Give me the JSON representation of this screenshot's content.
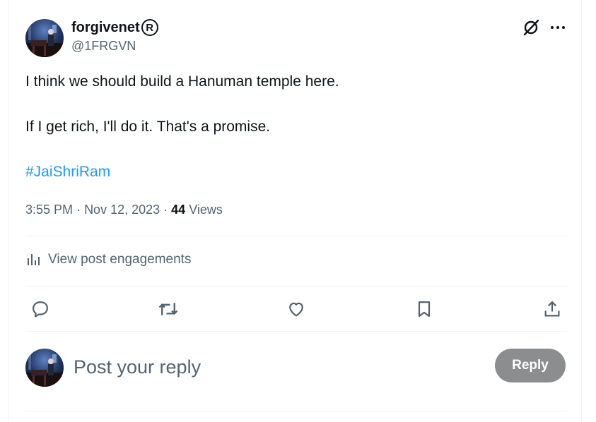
{
  "author": {
    "display_name": "forgivenet",
    "verified_mark": "R",
    "handle": "@1FRGVN",
    "avatar": "pianist-avatar"
  },
  "top_icons": [
    "grok-slash-icon",
    "more-icon"
  ],
  "post": {
    "lines": [
      "I think we should build a Hanuman temple here.",
      "If I get rich, I'll do it. That's a promise.",
      "#JaiShriRam"
    ],
    "time": "3:55 PM",
    "date": "Nov 12, 2023",
    "views_count": "44",
    "views_label": "Views"
  },
  "engagements_label": "View post engagements",
  "actions": [
    "reply-icon",
    "retweet-icon",
    "like-icon",
    "bookmark-icon",
    "share-icon"
  ],
  "reply": {
    "placeholder": "Post your reply",
    "button_label": "Reply"
  },
  "colors": {
    "accent": "#1d9bf0",
    "muted": "#536471",
    "reply_button": "#8b8d8f"
  }
}
